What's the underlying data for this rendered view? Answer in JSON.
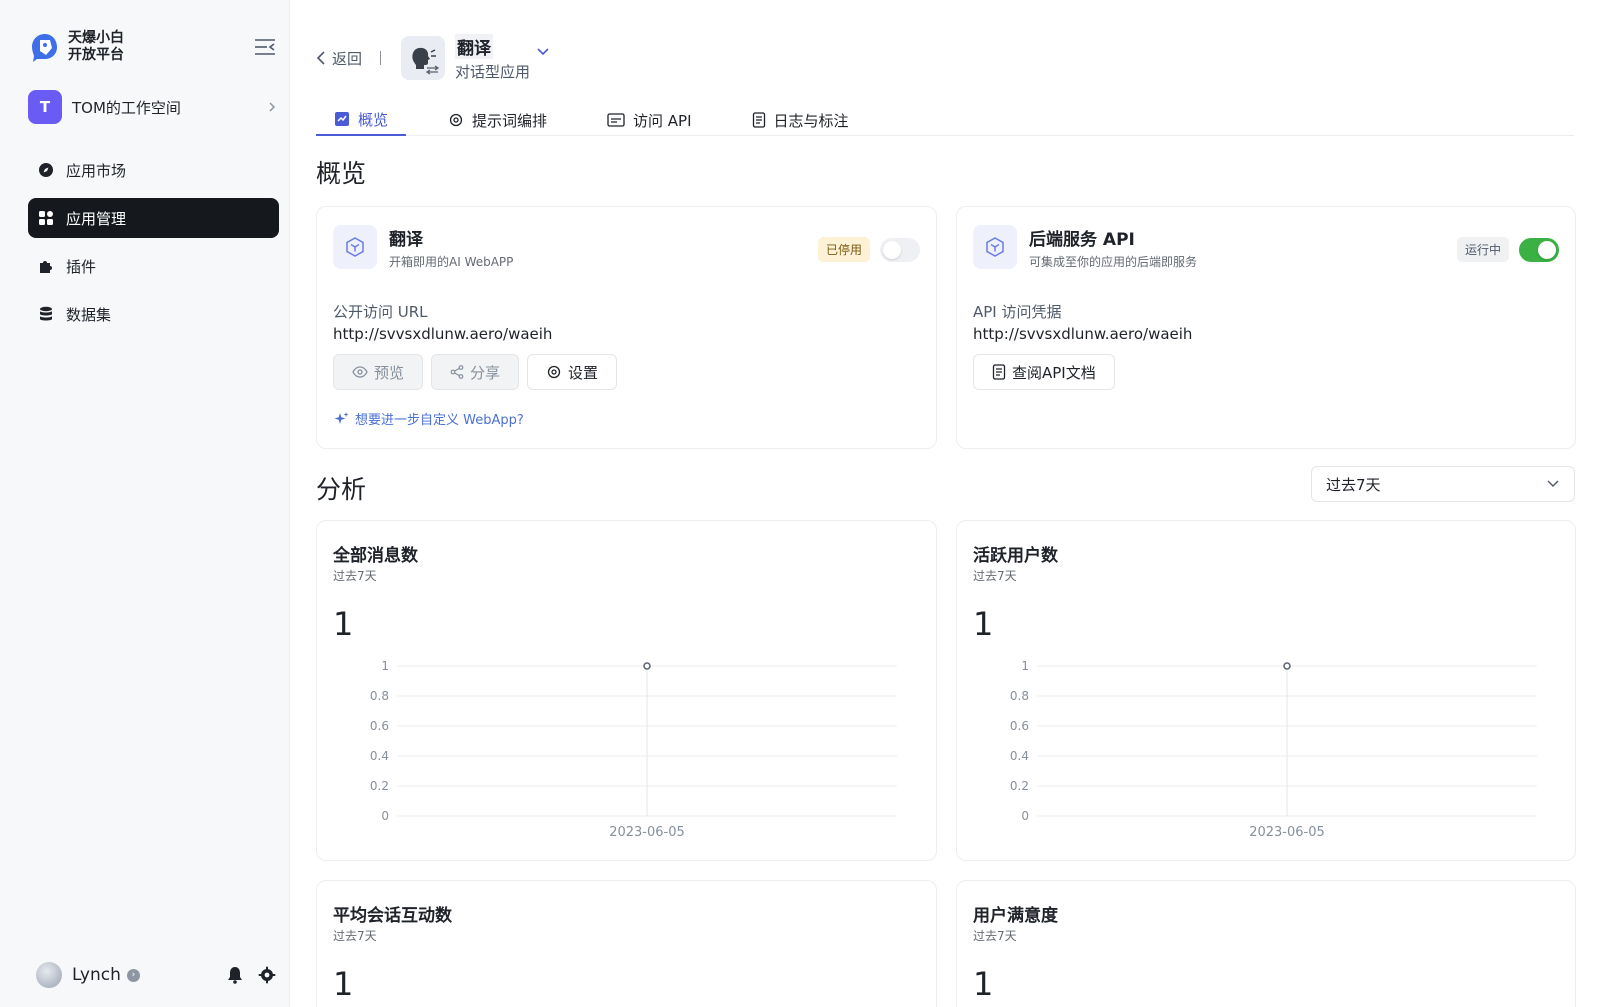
{
  "brand": {
    "line1": "天爆小白",
    "line2": "开放平台"
  },
  "workspace": {
    "initial": "T",
    "name": "TOM的工作空间"
  },
  "nav": [
    {
      "label": "应用市场",
      "icon": "compass-icon",
      "active": false
    },
    {
      "label": "应用管理",
      "icon": "grid-icon",
      "active": true
    },
    {
      "label": "插件",
      "icon": "puzzle-icon",
      "active": false
    },
    {
      "label": "数据集",
      "icon": "database-icon",
      "active": false
    }
  ],
  "user": {
    "name": "Lynch"
  },
  "header": {
    "back_label": "返回",
    "app_name": "翻译",
    "app_type": "对话型应用"
  },
  "tabs": [
    {
      "label": "概览",
      "active": true
    },
    {
      "label": "提示词编排",
      "active": false
    },
    {
      "label": "访问 API",
      "active": false
    },
    {
      "label": "日志与标注",
      "active": false
    }
  ],
  "overview": {
    "title": "概览",
    "webapp": {
      "title": "翻译",
      "subtitle": "开箱即用的AI WebAPP",
      "status": "已停用",
      "enabled": false,
      "field_label": "公开访问 URL",
      "field_value": "http://svvsxdlunw.aero/waeih",
      "buttons": {
        "preview": "预览",
        "share": "分享",
        "settings": "设置"
      },
      "custom_link": "想要进一步自定义 WebApp?"
    },
    "api": {
      "title": "后端服务 API",
      "subtitle": "可集成至你的应用的后端即服务",
      "status": "运行中",
      "enabled": true,
      "field_label": "API 访问凭据",
      "field_value": "http://svvsxdlunw.aero/waeih",
      "doc_button": "查阅API文档"
    }
  },
  "analysis": {
    "title": "分析",
    "period_select": "过去7天",
    "cards": [
      {
        "title": "全部消息数",
        "period": "过去7天",
        "value": "1"
      },
      {
        "title": "活跃用户数",
        "period": "过去7天",
        "value": "1"
      },
      {
        "title": "平均会话互动数",
        "period": "过去7天",
        "value": "1"
      },
      {
        "title": "用户满意度",
        "period": "过去7天",
        "value": "1"
      }
    ]
  },
  "chart_data": [
    {
      "type": "line",
      "title": "全部消息数",
      "x": [
        "2023-06-05"
      ],
      "series": [
        {
          "values": [
            1
          ]
        }
      ],
      "yticks": [
        "0",
        "0.2",
        "0.4",
        "0.6",
        "0.8",
        "1"
      ],
      "ylim": [
        0,
        1
      ],
      "grid": true
    },
    {
      "type": "line",
      "title": "活跃用户数",
      "x": [
        "2023-06-05"
      ],
      "series": [
        {
          "values": [
            1
          ]
        }
      ],
      "yticks": [
        "0",
        "0.2",
        "0.4",
        "0.6",
        "0.8",
        "1"
      ],
      "ylim": [
        0,
        1
      ],
      "grid": true
    }
  ],
  "colors": {
    "accent": "#4a5bd6",
    "nav_active": "#15181d",
    "toggle_on": "#3bb143",
    "workspace": "#6b5bf5"
  }
}
